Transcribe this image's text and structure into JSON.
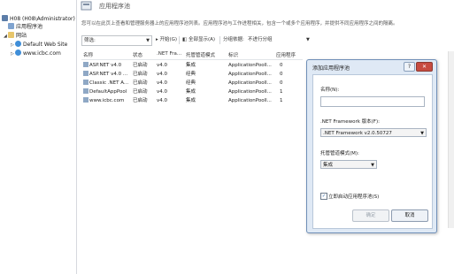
{
  "tree": {
    "items": [
      {
        "label": "H08 (H08\\Administrator)",
        "icon": "server-icon"
      },
      {
        "label": "应用程序池",
        "icon": "app-pool-icon"
      },
      {
        "label": "网站",
        "icon": "folder-icon"
      },
      {
        "label": "Default Web Site",
        "icon": "globe-icon"
      },
      {
        "label": "www.icbc.com",
        "icon": "globe-icon"
      }
    ]
  },
  "header": {
    "title": "应用程序池",
    "description": "您可以在此页上查看和管理服务器上的应用程序池列表。应用程序池与工作进程相关，包含一个或多个应用程序，并提供不同应用程序之间的隔离。"
  },
  "filterbar": {
    "filter_label": "筛选:",
    "go_label": "开始(G)",
    "show_all_label": "全部显示(A)",
    "group_label": "分组依据:",
    "group_value": "不进行分组"
  },
  "table": {
    "columns": [
      "名称",
      "状态",
      ".NET Fra...",
      "托管管道模式",
      "标识",
      "应用程序"
    ],
    "rows": [
      {
        "name": "ASP.NET v4.0",
        "status": "已启动",
        "net": "v4.0",
        "pipeline": "集成",
        "identity": "ApplicationPooll...",
        "apps": "0"
      },
      {
        "name": "ASP.NET v4.0 ...",
        "status": "已启动",
        "net": "v4.0",
        "pipeline": "经典",
        "identity": "ApplicationPooll...",
        "apps": "0"
      },
      {
        "name": "Classic .NET A...",
        "status": "已启动",
        "net": "v4.0",
        "pipeline": "经典",
        "identity": "ApplicationPooll...",
        "apps": "0"
      },
      {
        "name": "DefaultAppPool",
        "status": "已启动",
        "net": "v4.0",
        "pipeline": "集成",
        "identity": "ApplicationPooll...",
        "apps": "1"
      },
      {
        "name": "www.icbc.com",
        "status": "已启动",
        "net": "v4.0",
        "pipeline": "集成",
        "identity": "ApplicationPooll...",
        "apps": "1"
      }
    ]
  },
  "dialog": {
    "title": "添加应用程序池",
    "help_label": "?",
    "close_label": "✕",
    "name_label": "名称(N):",
    "name_value": "",
    "framework_label": ".NET Framework 版本(F):",
    "framework_value": ".NET Framework v2.0.50727",
    "pipeline_label": "托管管道模式(M):",
    "pipeline_value": "集成",
    "start_label": "立即启动应用程序池(S)",
    "start_checked": true,
    "ok_label": "确定",
    "cancel_label": "取消"
  }
}
